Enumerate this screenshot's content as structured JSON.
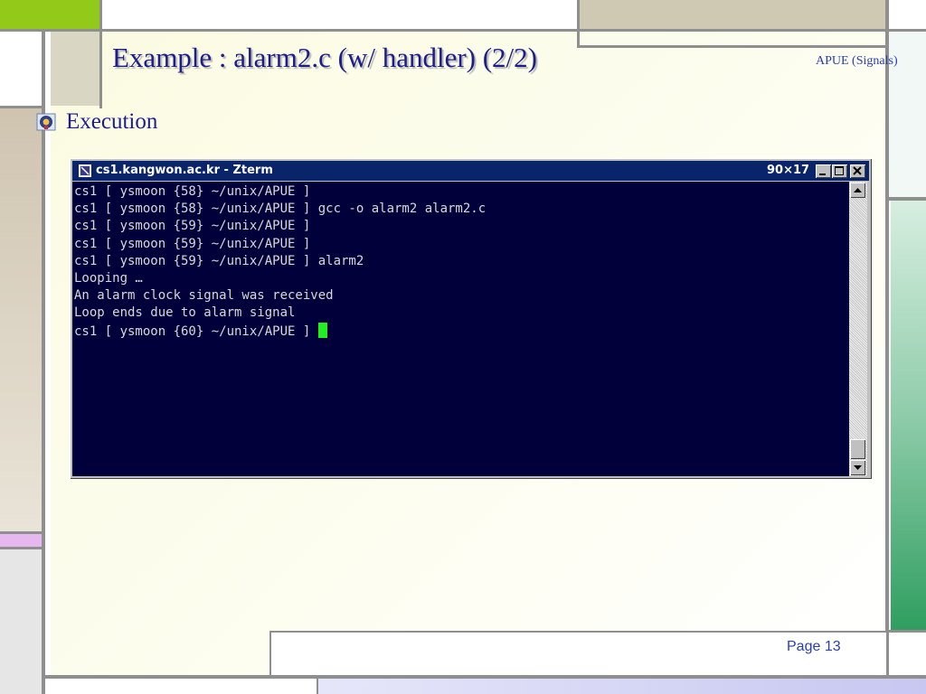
{
  "slide": {
    "title": "Example : alarm2.c (w/ handler) (2/2)",
    "header_tag": "APUE (Signals)",
    "bullet": "Execution",
    "page": "Page 13"
  },
  "terminal": {
    "title": "cs1.kangwon.ac.kr - Zterm",
    "size": "90×17",
    "lines": [
      "cs1 [ ysmoon {58} ~/unix/APUE ]",
      "cs1 [ ysmoon {58} ~/unix/APUE ] gcc -o alarm2 alarm2.c",
      "cs1 [ ysmoon {59} ~/unix/APUE ]",
      "cs1 [ ysmoon {59} ~/unix/APUE ]",
      "cs1 [ ysmoon {59} ~/unix/APUE ] alarm2",
      "Looping …",
      "An alarm clock signal was received",
      "Loop ends due to alarm signal",
      "cs1 [ ysmoon {60} ~/unix/APUE ] "
    ],
    "cursor_color": "#22ee22",
    "background": "#02003a",
    "titlebar_color": "#0a246a"
  },
  "colors": {
    "title": "#1d1d8a",
    "accent_green": "#93c918",
    "accent_teal": "#2f9e5f",
    "accent_pink": "#e6b8ef",
    "accent_tan": "#cec7b4"
  }
}
